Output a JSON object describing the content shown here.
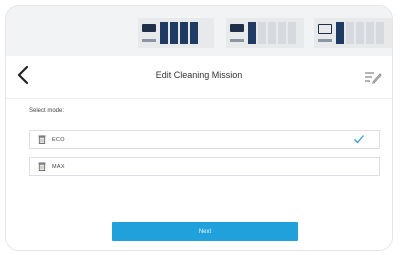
{
  "status": {
    "cards": [
      {
        "name": "status-card-1",
        "icon": "device-icon",
        "bars_total": 4,
        "bars_on": 4
      },
      {
        "name": "status-card-2",
        "icon": "device-icon",
        "bars_total": 5,
        "bars_on": 1
      },
      {
        "name": "status-card-3",
        "icon": "device-outline-icon",
        "bars_total": 5,
        "bars_on": 1
      }
    ]
  },
  "header": {
    "back_icon": "chevron-left-icon",
    "title": "Edit Cleaning Mission",
    "edit_icon": "edit-list-icon"
  },
  "mode": {
    "label": "Select mode:",
    "options": [
      {
        "label": "ECO",
        "icon": "trash-bin-icon",
        "selected": true
      },
      {
        "label": "MAX",
        "icon": "trash-bin-icon",
        "selected": false
      }
    ]
  },
  "footer": {
    "next_label": "Next"
  },
  "colors": {
    "accent": "#20a1dc",
    "check": "#3a9bd5",
    "bar_on": "#1f3b63"
  }
}
